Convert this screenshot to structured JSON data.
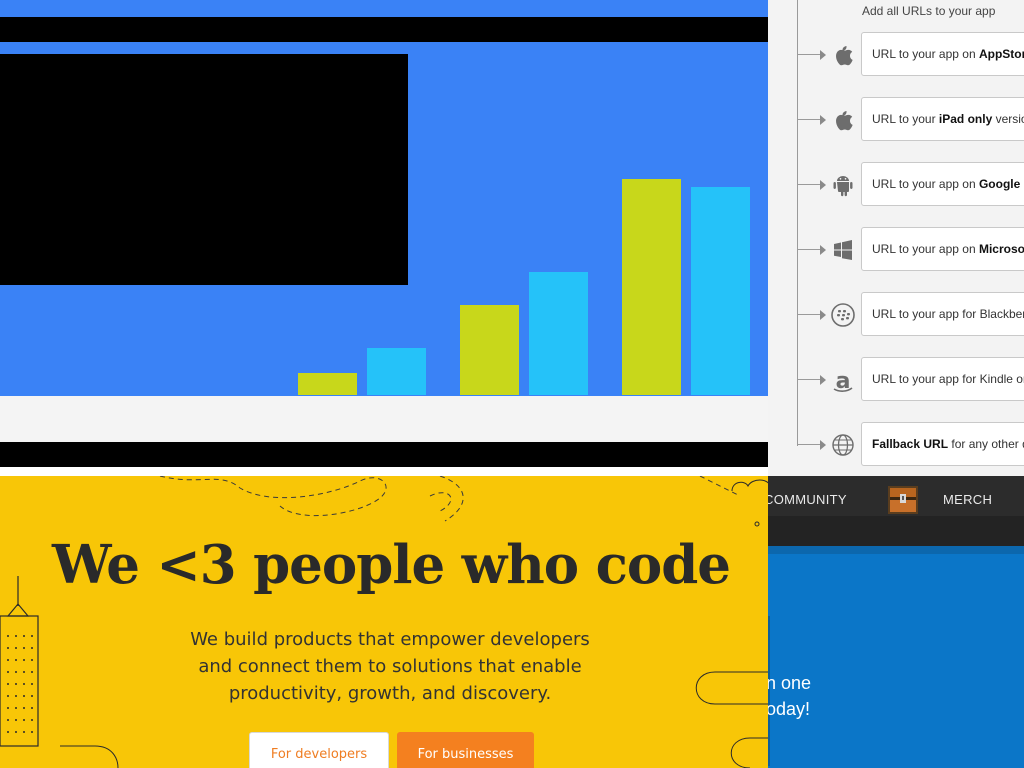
{
  "url_panel": {
    "header": "Add all URLs to your app",
    "rows": [
      {
        "icon": "apple-icon",
        "prefix": "URL to your app on ",
        "bold": "AppStore",
        "suffix": ""
      },
      {
        "icon": "apple-icon",
        "prefix": "URL to your ",
        "bold": "iPad only",
        "suffix": " version"
      },
      {
        "icon": "android-icon",
        "prefix": "URL to your app on ",
        "bold": "Google Pl",
        "suffix": ""
      },
      {
        "icon": "windows-icon",
        "prefix": "URL to your app on ",
        "bold": "Microsoft",
        "suffix": ""
      },
      {
        "icon": "blackberry-icon",
        "prefix": "URL to your app for Blackber",
        "bold": "",
        "suffix": ""
      },
      {
        "icon": "amazon-icon",
        "prefix": "URL to your app for Kindle or",
        "bold": "",
        "suffix": ""
      },
      {
        "icon": "globe-icon",
        "prefix": "",
        "bold": "Fallback URL",
        "suffix": " for any other de"
      }
    ]
  },
  "chart_data": {
    "type": "bar",
    "categories": [
      "",
      "",
      ""
    ],
    "series": [
      {
        "values": [
          22,
          90,
          216
        ]
      },
      {
        "values": [
          47,
          123,
          208
        ]
      }
    ],
    "ylim": [
      0,
      216
    ],
    "colors": [
      "#c8d71b",
      "#25c2f9"
    ],
    "grid": false
  },
  "hero": {
    "title": "We <3 people who code",
    "subtitle_lines": [
      "We build products that empower developers",
      "and connect them to solutions that enable",
      "productivity, growth, and discovery."
    ],
    "btn_developers": "For developers",
    "btn_businesses": "For businesses",
    "colors": {
      "background": "#f8c607",
      "accent": "#f4801f"
    }
  },
  "game_site": {
    "nav_community": "COMMUNITY",
    "nav_merch": "MERCH",
    "chest_icon": "treasure-chest-icon",
    "promo_lines": [
      "n one",
      "oday!"
    ]
  }
}
